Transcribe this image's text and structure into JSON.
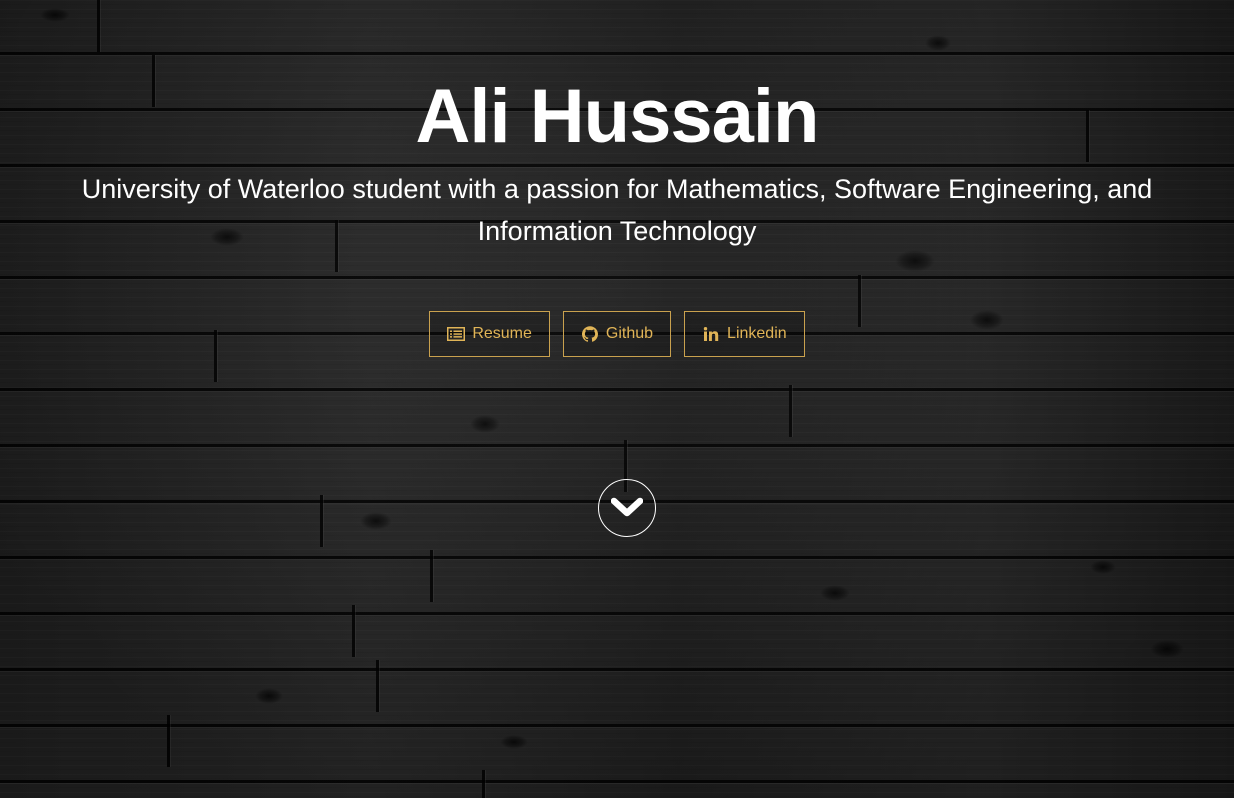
{
  "hero": {
    "title": "Ali Hussain",
    "subtitle": "University of Waterloo student with a passion for Mathematics, Software Engineering, and Information Technology"
  },
  "buttons": [
    {
      "label": "Resume",
      "icon": "document-list-icon"
    },
    {
      "label": "Github",
      "icon": "github-icon"
    },
    {
      "label": "Linkedin",
      "icon": "linkedin-icon"
    }
  ],
  "scroll_down": {
    "icon": "chevron-down-icon"
  },
  "colors": {
    "accent": "#e0b457",
    "button_border": "#c9a14e",
    "text": "#ffffff",
    "background": "#1d1d1d"
  }
}
